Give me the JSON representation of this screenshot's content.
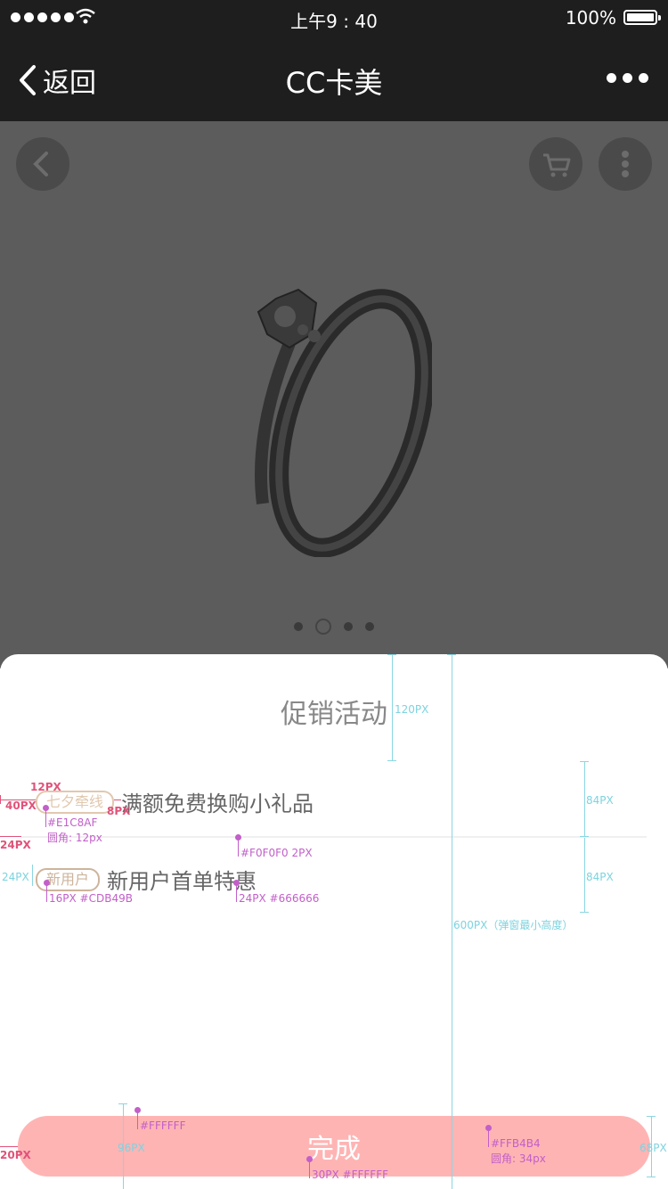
{
  "status_bar": {
    "time": "上午9 : 40",
    "battery": "100%"
  },
  "navbar": {
    "back_label": "返回",
    "title": "CC卡美"
  },
  "product": {
    "carousel_pages": 4,
    "active_page": 2
  },
  "popup": {
    "title": "促销活动",
    "promotions": [
      {
        "tag": "七夕牵线",
        "text": "满额免费换购小礼品",
        "tag_color": "#E1C8AF"
      },
      {
        "tag": "新用户",
        "text": "新用户首单特惠",
        "tag_color": "#CDB49B"
      }
    ],
    "done_label": "完成"
  },
  "colors": {
    "button": "#FFB4B4",
    "divider": "#F0F0F0",
    "text": "#666666"
  },
  "annotations": {
    "title_height": "120PX",
    "row1_height": "84PX",
    "row2_height": "84PX",
    "sheet_min": "600PX（弹窗最小高度）",
    "tag1_radius_px": "12PX",
    "tag1_left": "40PX",
    "tag1_gap": "8PX",
    "tag1_color": "#E1C8AF",
    "tag1_radius": "圆角: 12px",
    "divider_left": "24PX",
    "divider_spec": "#F0F0F0  2PX",
    "tag2_height": "24PX",
    "tag2_spec": "16PX  #CDB49B",
    "text_spec": "24PX  #666666",
    "btn_left": "20PX",
    "btn_pad": "96PX",
    "btn_text_color": "#FFFFFF",
    "btn_font": "30PX  #FFFFFF",
    "btn_color": "#FFB4B4",
    "btn_radius": "圆角: 34px",
    "btn_height": "68PX"
  }
}
